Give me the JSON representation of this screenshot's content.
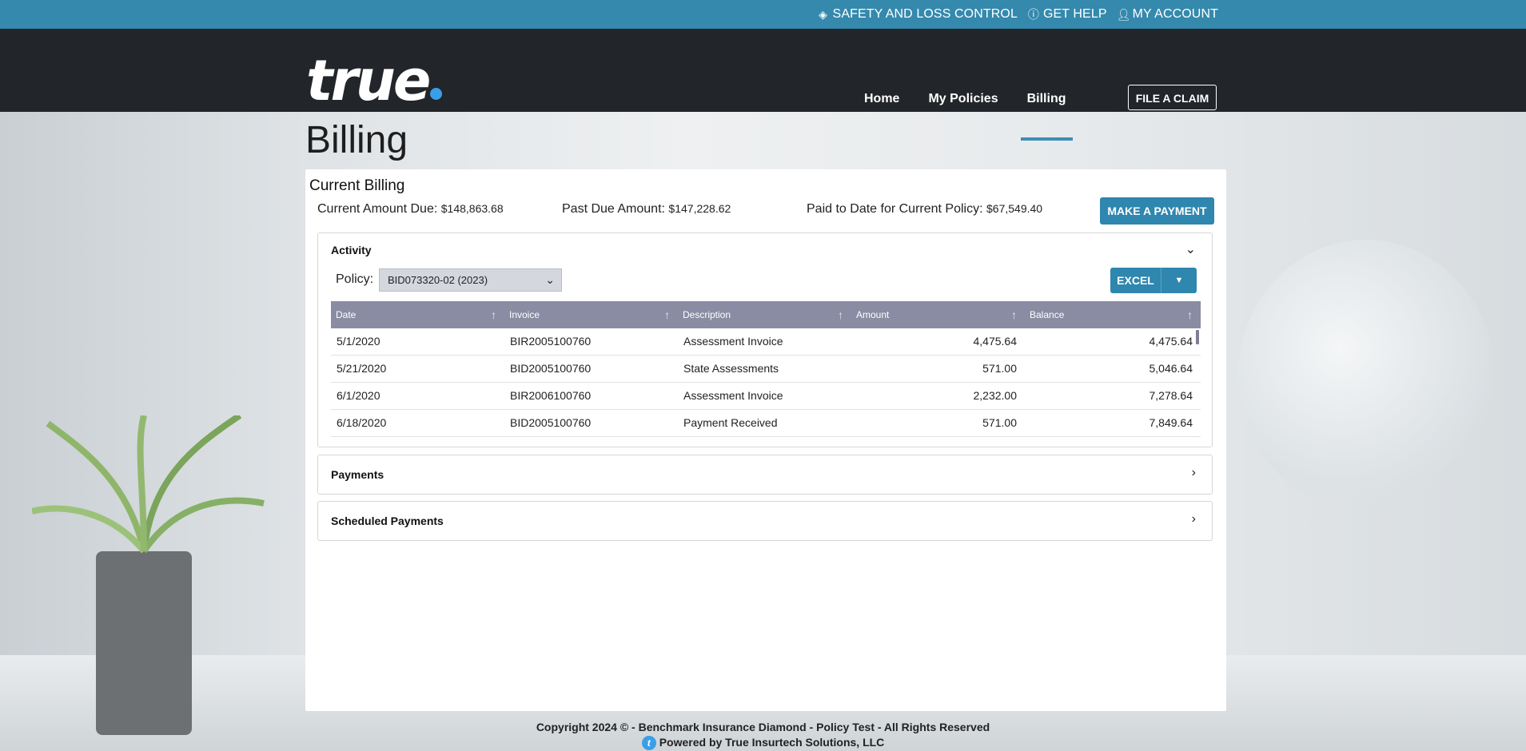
{
  "utility": {
    "safety": "SAFETY AND LOSS CONTROL",
    "help": "GET HELP",
    "account": "MY ACCOUNT"
  },
  "header": {
    "logo_text": "true",
    "nav": [
      "Home",
      "My Policies",
      "Billing"
    ],
    "active_nav": "Billing",
    "claim_button": "FILE A CLAIM"
  },
  "page_title": "Billing",
  "current_billing": {
    "title": "Current Billing",
    "amount_due_label": "Current Amount Due:",
    "amount_due": "$148,863.68",
    "past_due_label": "Past Due Amount:",
    "past_due": "$147,228.62",
    "paid_label": "Paid to Date for Current Policy:",
    "paid": "$67,549.40",
    "pay_button": "MAKE A PAYMENT"
  },
  "activity": {
    "title": "Activity",
    "policy_label": "Policy:",
    "policy_value": "BID073320-02 (2023)",
    "excel_button": "EXCEL",
    "columns": [
      "Date",
      "Invoice",
      "Description",
      "Amount",
      "Balance"
    ],
    "rows": [
      [
        "5/1/2020",
        "BIR2005100760",
        "Assessment Invoice",
        "4,475.64",
        "4,475.64"
      ],
      [
        "5/21/2020",
        "BID2005100760",
        "State Assessments",
        "571.00",
        "5,046.64"
      ],
      [
        "6/1/2020",
        "BIR2006100760",
        "Assessment Invoice",
        "2,232.00",
        "7,278.64"
      ],
      [
        "6/18/2020",
        "BID2005100760",
        "Payment Received",
        "571.00",
        "7,849.64"
      ]
    ]
  },
  "payments": {
    "title": "Payments"
  },
  "scheduled_payments": {
    "title": "Scheduled Payments"
  },
  "footer": {
    "copyright": "Copyright 2024 © - Benchmark Insurance Diamond - Policy Test - All Rights Reserved",
    "powered": "Powered by True Insurtech Solutions, LLC"
  },
  "colors": {
    "utility_bar": "#3489ad",
    "header": "#222529",
    "accent": "#2f86ae",
    "grid_header": "#8a8ca3"
  }
}
